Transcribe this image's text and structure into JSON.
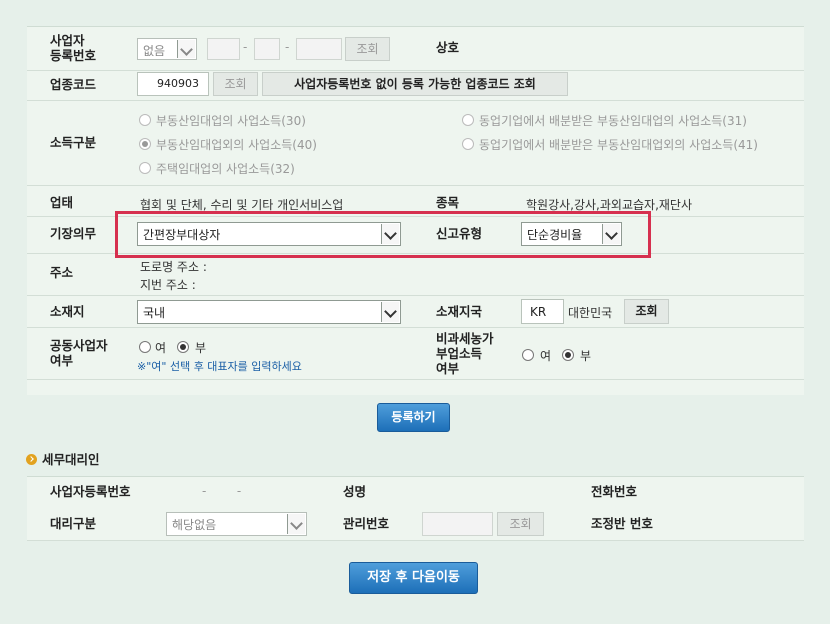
{
  "business_reg": {
    "label": "사업자\n등록번호",
    "select_value": "없음",
    "dash1": "-",
    "dash2": "-",
    "lookup": "조회",
    "shop_label": "상호"
  },
  "industry_code": {
    "label": "업종코드",
    "value": "940903",
    "lookup": "조회",
    "lookup_no_reg": "사업자등록번호 없이 등록 가능한 업종코드 조회"
  },
  "income_type": {
    "label": "소득구분",
    "options": [
      "부동산임대업의 사업소득(30)",
      "동업기업에서 배분받은 부동산임대업의 사업소득(31)",
      "부동산임대업외의 사업소득(40)",
      "동업기업에서 배분받은 부동산임대업외의 사업소득(41)",
      "주택임대업의 사업소득(32)"
    ]
  },
  "business_type": {
    "label": "업태",
    "value": "협회 및 단체, 수리 및 기타 개인서비스업",
    "item_label": "종목",
    "item_value": "학원강사,강사,과외교습자,재단사"
  },
  "bookkeeping": {
    "label": "기장의무",
    "value": "간편장부대상자",
    "report_label": "신고유형",
    "report_value": "단순경비율"
  },
  "address": {
    "label": "주소",
    "road": "도로명 주소 :",
    "lot": "지번 주소 :"
  },
  "location": {
    "label": "소재지",
    "value": "국내",
    "country_label": "소재지국",
    "country_code": "KR",
    "country_name": "대한민국",
    "lookup": "조회"
  },
  "joint_business": {
    "label": "공동사업자\n여부",
    "yes": "여",
    "no": "부",
    "note": "※\"여\" 선택 후 대표자를 입력하세요"
  },
  "nontax_farm": {
    "label": "비과세농가\n부업소득\n여부",
    "yes": "여",
    "no": "부"
  },
  "register_button": "등록하기",
  "tax_agent": {
    "title": "세무대리인",
    "reg_label": "사업자등록번호",
    "reg_value": "-        -",
    "name_label": "성명",
    "phone_label": "전화번호",
    "agent_type_label": "대리구분",
    "agent_type_value": "해당없음",
    "mgmt_label": "관리번호",
    "lookup": "조회",
    "adjust_label": "조정반 번호"
  },
  "save_next_button": "저장 후 다음이동",
  "colors": {
    "accent": "#1d6fb8",
    "highlight": "#d6304f",
    "bullet": "#e2a21f"
  }
}
